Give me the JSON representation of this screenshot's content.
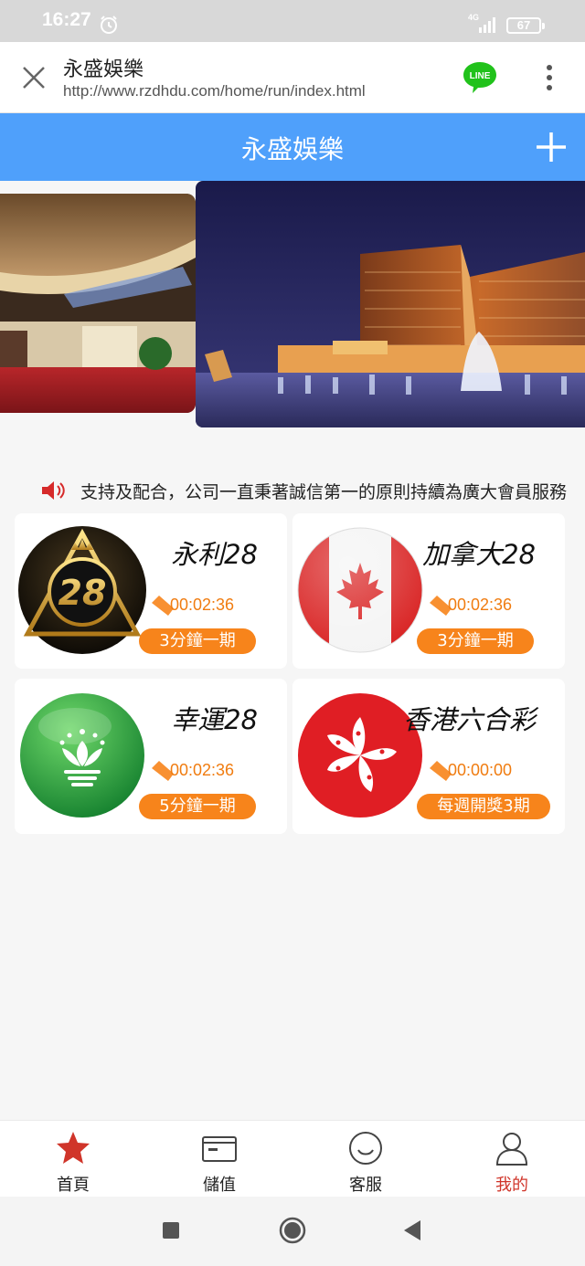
{
  "status_bar": {
    "time": "16:27",
    "network": "4G",
    "battery": "67"
  },
  "browser": {
    "title": "永盛娛樂",
    "url": "http://www.rzdhdu.com/home/run/index.html",
    "line_label": "LINE"
  },
  "app": {
    "title": "永盛娛樂"
  },
  "notice": {
    "text": "支持及配合，公司一直秉著誠信第一的原則持續為廣大會員服務"
  },
  "games": [
    {
      "name": "永利28",
      "logo_text": "28",
      "countdown": "00:02:36",
      "period": "3分鐘一期"
    },
    {
      "name": "加拿大28",
      "countdown": "00:02:36",
      "period": "3分鐘一期"
    },
    {
      "name": "幸運28",
      "countdown": "00:02:36",
      "period": "5分鐘一期"
    },
    {
      "name": "香港六合彩",
      "countdown": "00:00:00",
      "period": "每週開獎3期"
    }
  ],
  "nav": {
    "items": [
      {
        "label": "首頁"
      },
      {
        "label": "儲值"
      },
      {
        "label": "客服"
      },
      {
        "label": "我的"
      }
    ]
  },
  "colors": {
    "accent": "#4fa0fb",
    "orange": "#f7841b",
    "active_nav": "#d0352a"
  }
}
